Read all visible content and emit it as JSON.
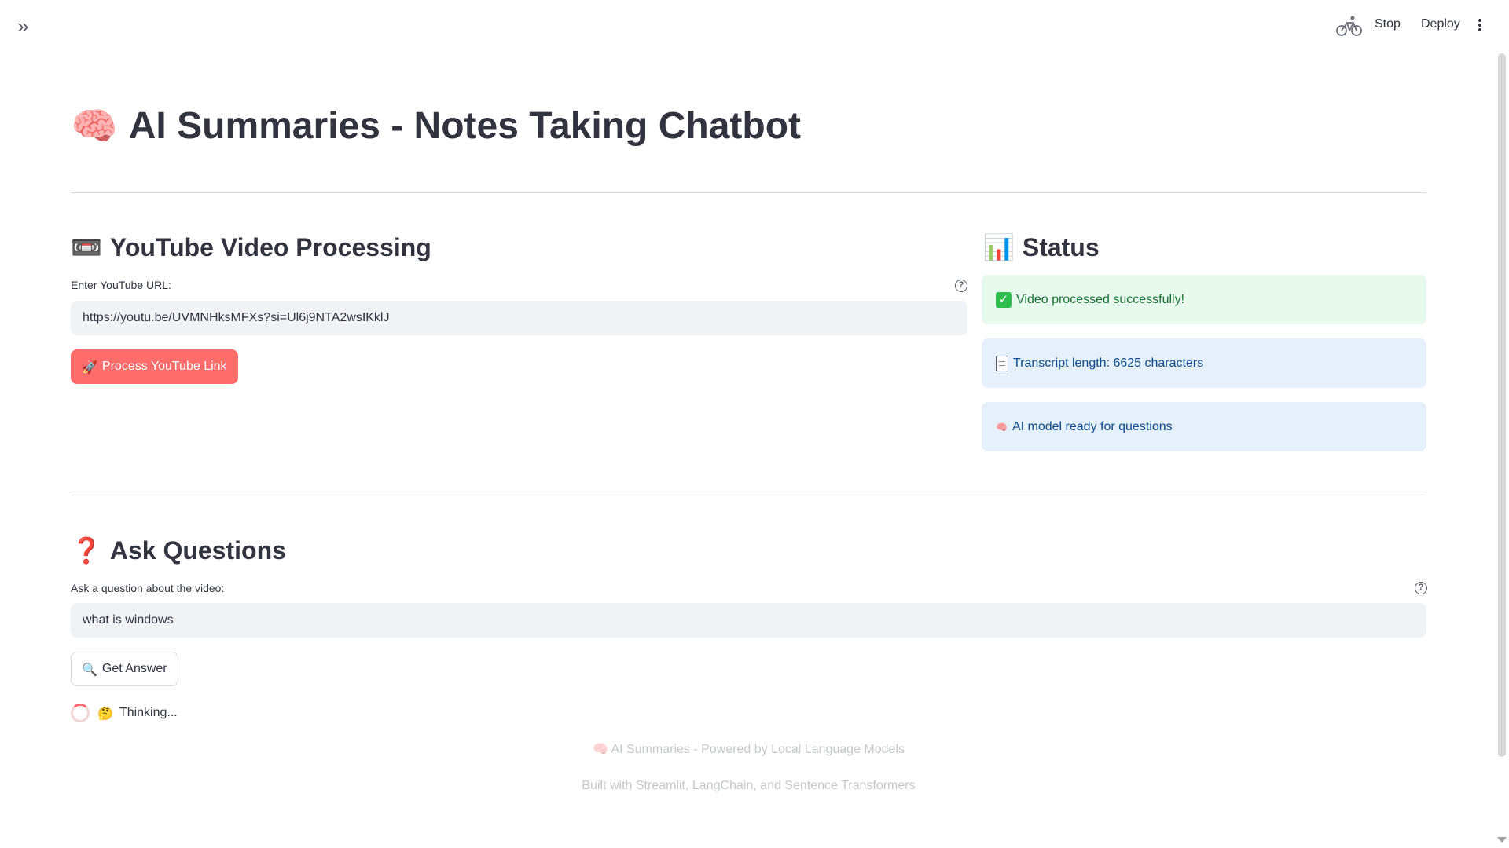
{
  "topbar": {
    "sidebar_toggle_icon": "chevron-double-right-icon",
    "running_icon": "bicycle-icon",
    "stop_label": "Stop",
    "deploy_label": "Deploy",
    "menu_icon": "kebab-menu-icon"
  },
  "page": {
    "title_emoji": "🧠",
    "title": "AI Summaries - Notes Taking Chatbot"
  },
  "video_section": {
    "emoji": "📼",
    "heading": "YouTube Video Processing",
    "url_label": "Enter YouTube URL:",
    "url_value": "https://youtu.be/UVMNHksMFXs?si=Ul6j9NTA2wsIKklJ",
    "process_button_emoji": "🚀",
    "process_button_label": "Process YouTube Link"
  },
  "status_section": {
    "emoji": "📊",
    "heading": "Status",
    "success_message": "Video processed successfully!",
    "transcript_message": "Transcript length: 6625 characters",
    "model_message_emoji": "🧠",
    "model_message": "AI model ready for questions"
  },
  "questions_section": {
    "emoji": "❓",
    "heading": "Ask Questions",
    "question_label": "Ask a question about the video:",
    "question_value": "what is windows",
    "answer_button_emoji": "🔍",
    "answer_button_label": "Get Answer",
    "thinking_emoji": "🤔",
    "thinking_text": "Thinking..."
  },
  "footer": {
    "line1_emoji": "🧠",
    "line1": "AI Summaries - Powered by Local Language Models",
    "line2": "Built with Streamlit, LangChain, and Sentence Transformers"
  },
  "colors": {
    "primary": "#ff6c6c",
    "success_bg": "#e8f9ee",
    "info_bg": "#e6f0fb",
    "input_bg": "#f0f2f6"
  }
}
